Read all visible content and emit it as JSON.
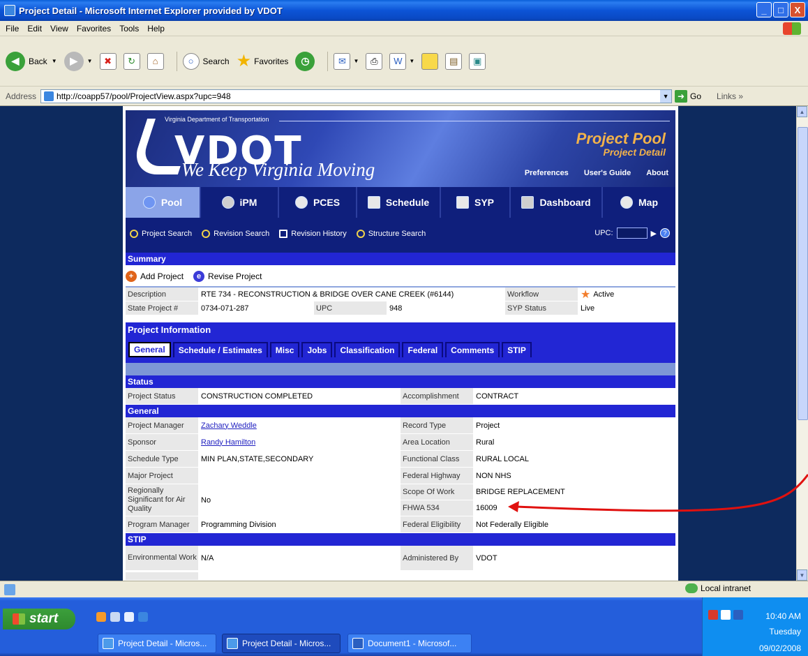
{
  "window": {
    "title": "Project Detail - Microsoft Internet Explorer provided by VDOT",
    "min": "_",
    "max": "□",
    "close": "X"
  },
  "menu": [
    "File",
    "Edit",
    "View",
    "Favorites",
    "Tools",
    "Help"
  ],
  "toolbar": {
    "back": "Back",
    "search": "Search",
    "favorites": "Favorites"
  },
  "address": {
    "label": "Address",
    "url": "http://coapp57/pool/ProjectView.aspx?upc=948",
    "go": "Go",
    "links": "Links"
  },
  "banner": {
    "org": "Virginia Department of Transportation",
    "logo": "VDOT",
    "tagline": "We Keep Virginia Moving",
    "pool": "Project Pool",
    "detail": "Project Detail",
    "links": [
      "Preferences",
      "User's Guide",
      "About"
    ]
  },
  "mainnav": [
    "Pool",
    "iPM",
    "PCES",
    "Schedule",
    "SYP",
    "Dashboard",
    "Map"
  ],
  "subnav": {
    "items": [
      "Project Search",
      "Revision Search",
      "Revision History",
      "Structure Search"
    ],
    "upc_label": "UPC:"
  },
  "summary": {
    "heading": "Summary",
    "actions": [
      "Add Project",
      "Revise Project"
    ],
    "description_label": "Description",
    "description": "RTE 734 - RECONSTRUCTION & BRIDGE OVER CANE CREEK (#6144)",
    "workflow_label": "Workflow",
    "workflow": "Active",
    "state_project_label": "State Project #",
    "state_project": "0734-071-287",
    "upc_label": "UPC",
    "upc": "948",
    "syp_status_label": "SYP Status",
    "syp_status": "Live"
  },
  "project_info": {
    "heading": "Project Information",
    "tabs": [
      "General",
      "Schedule / Estimates",
      "Misc",
      "Jobs",
      "Classification",
      "Federal",
      "Comments",
      "STIP"
    ]
  },
  "status": {
    "heading": "Status",
    "project_status_label": "Project Status",
    "project_status": "CONSTRUCTION COMPLETED",
    "accomplishment_label": "Accomplishment",
    "accomplishment": "CONTRACT"
  },
  "general": {
    "heading": "General",
    "left": [
      {
        "label": "Project Manager",
        "value": "Zachary Weddle",
        "link": true
      },
      {
        "label": "Sponsor",
        "value": "Randy Hamilton",
        "link": true
      },
      {
        "label": "Schedule Type",
        "value": "MIN PLAN,STATE,SECONDARY",
        "link": false
      },
      {
        "label": "Major Project",
        "value": "",
        "link": false
      },
      {
        "label": "Regionally Significant for Air Quality",
        "value": "No",
        "link": false
      },
      {
        "label": "Program Manager",
        "value": "Programming Division",
        "link": false
      }
    ],
    "right": [
      {
        "label": "Record Type",
        "value": "Project"
      },
      {
        "label": "Area Location",
        "value": "Rural"
      },
      {
        "label": "Functional Class",
        "value": "RURAL LOCAL"
      },
      {
        "label": "Federal Highway",
        "value": "NON NHS"
      },
      {
        "label": "Scope Of Work",
        "value": "BRIDGE REPLACEMENT"
      },
      {
        "label": "FHWA 534",
        "value": "16009"
      },
      {
        "label": "Federal Eligibility",
        "value": "Not Federally Eligible"
      }
    ]
  },
  "stip": {
    "heading": "STIP",
    "env_label": "Environmental Work",
    "env_value": "N/A",
    "admin_label": "Administered By",
    "admin_value": "VDOT"
  },
  "statusbar": {
    "zone": "Local intranet"
  },
  "taskbar": {
    "start": "start",
    "tasks": [
      "Project Detail - Micros...",
      "Project Detail - Micros...",
      "Document1 - Microsof..."
    ],
    "time": "10:40 AM",
    "day": "Tuesday",
    "date": "09/02/2008"
  },
  "colors": {
    "section_header": "#2226d4",
    "nav": "#0f1f7c",
    "annotation_arrow": "#e0110f"
  }
}
